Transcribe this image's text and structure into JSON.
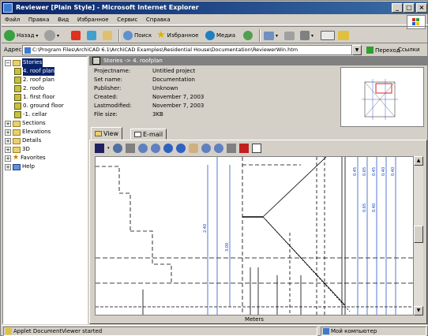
{
  "window": {
    "title": "Reviewer [Plain Style] - Microsoft Internet Explorer",
    "minimize": "_",
    "maximize": "□",
    "close": "×"
  },
  "menu": [
    "Файл",
    "Правка",
    "Вид",
    "Избранное",
    "Сервис",
    "Справка"
  ],
  "toolbar": {
    "back_label": "Назад",
    "search_label": "Поиск",
    "favorites_label": "Избранное",
    "media_label": "Медиа"
  },
  "address": {
    "label": "Адрес",
    "value": "C:\\Program Files\\ArchiCAD 6.1\\ArchiCAD Examples\\Residential House\\Documentation\\ReviewerWin.htm",
    "go_label": "Переход",
    "links_label": "Ссылки"
  },
  "tree": {
    "stories_label": "Stories",
    "stories": [
      "4. roof plan",
      "2. roof plan",
      "2. roofo",
      "1. first floor",
      "0. ground floor",
      "-1. cellar"
    ],
    "sections_label": "Sections",
    "elevations_label": "Elevations",
    "details_label": "Details",
    "threed_label": "3D",
    "favorites_label": "Favorites",
    "help_label": "Help"
  },
  "info": {
    "header": "Stories -> 4. roofplan",
    "rows": [
      {
        "key": "Projectname:",
        "value": "Untitled project"
      },
      {
        "key": "Set name:",
        "value": "Documentation"
      },
      {
        "key": "Publisher:",
        "value": "Unknown"
      },
      {
        "key": "Created:",
        "value": "November 7, 2003"
      },
      {
        "key": "Lastmodified:",
        "value": "November 7, 2003"
      },
      {
        "key": "File size:",
        "value": "3KB"
      }
    ]
  },
  "tabs": {
    "view_label": "View",
    "email_label": "E-mail"
  },
  "viewer": {
    "axis_label": "Meters",
    "dims": [
      "2.40",
      "0.45",
      "0.65",
      "0.45",
      "0.40",
      "0.40",
      "0.65",
      "0.40",
      "3.00"
    ]
  },
  "status": {
    "left": "Applet DocumentViewer started",
    "right": "Мой компьютер"
  }
}
